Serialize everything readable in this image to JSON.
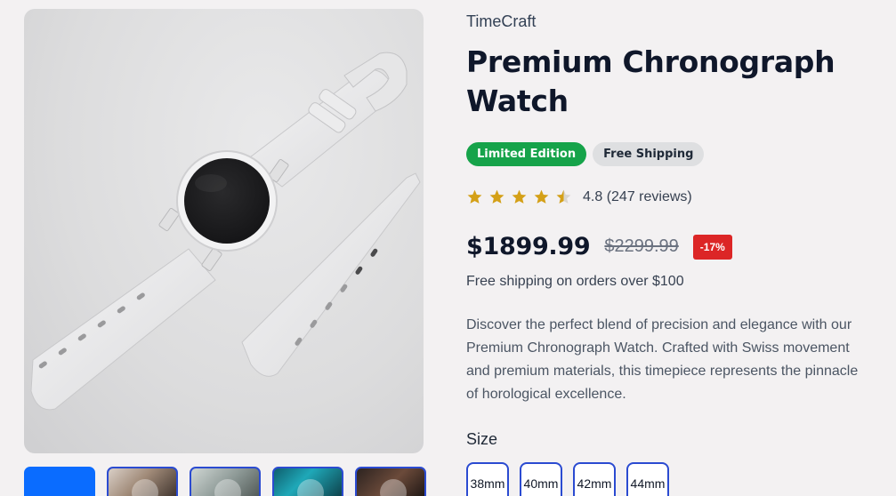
{
  "product": {
    "brand": "TimeCraft",
    "title": "Premium Chronograph Watch",
    "badges": [
      {
        "label": "Limited Edition",
        "color": "#16a34a"
      },
      {
        "label": "Free Shipping",
        "color": "#dedfe1"
      }
    ],
    "rating": {
      "value": 4.8,
      "max": 5,
      "text": "4.8 (247 reviews)",
      "star_color": "#d4a017"
    },
    "price": "$1899.99",
    "original_price": "$2299.99",
    "discount": "-17%",
    "shipping_note": "Free shipping on orders over $100",
    "description": "Discover the perfect blend of precision and elegance with our Premium Chronograph Watch. Crafted with Swiss movement and premium materials, this timepiece represents the pinnacle of horological excellence.",
    "size_label": "Size",
    "sizes": [
      "38mm",
      "40mm",
      "42mm",
      "44mm"
    ]
  },
  "gallery": {
    "main_image_icon": "white-smartwatch-image",
    "thumbnails": [
      {
        "icon": "thumbnail-active",
        "active": true
      },
      {
        "icon": "watch-on-wrist-thumbnail",
        "active": false
      },
      {
        "icon": "smartwatch-thumbnail",
        "active": false
      },
      {
        "icon": "chronograph-teal-thumbnail",
        "active": false
      },
      {
        "icon": "watch-dark-thumbnail",
        "active": false
      }
    ]
  },
  "colors": {
    "accent": "#2b4bd1",
    "active_thumb": "#0a6cff",
    "badge_green": "#16a34a",
    "discount_red": "#dc2626"
  }
}
